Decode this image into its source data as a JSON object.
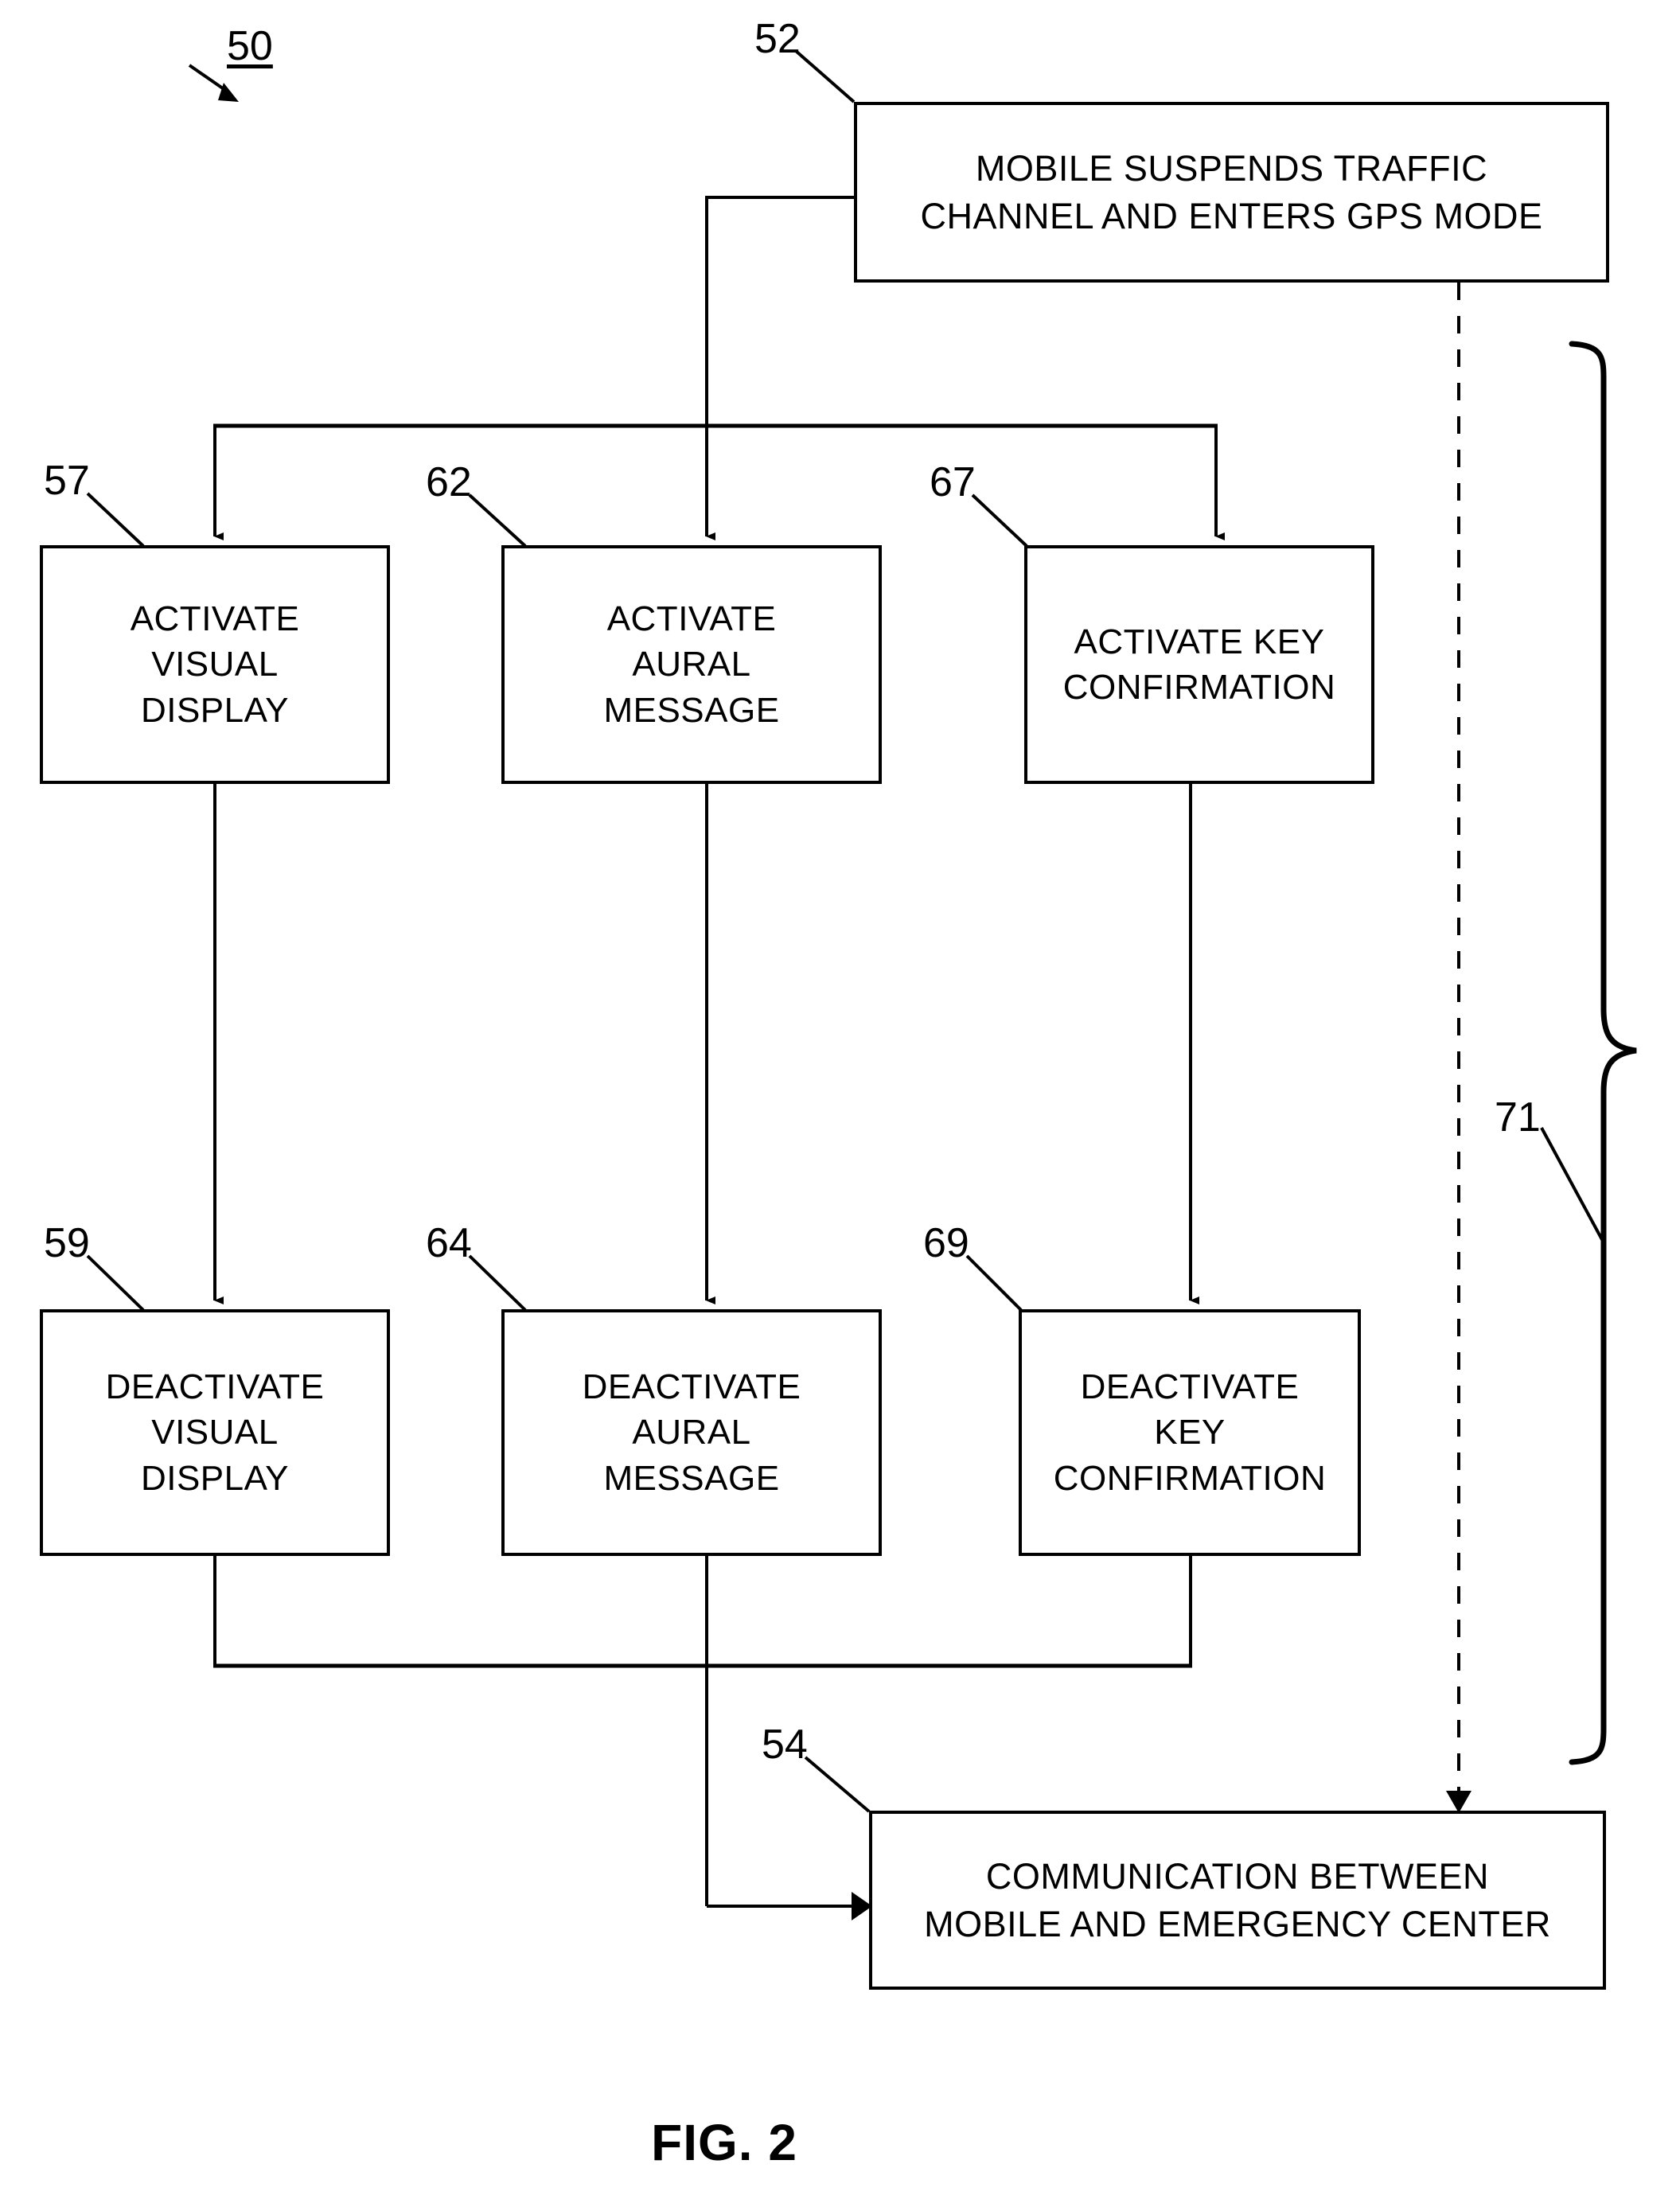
{
  "figure": {
    "caption": "FIG. 2",
    "diagram_ref": "50"
  },
  "nodes": [
    {
      "ref": "52",
      "name": "mobile-suspends-traffic",
      "text": "MOBILE SUSPENDS TRAFFIC\nCHANNEL AND ENTERS GPS MODE"
    },
    {
      "ref": "57",
      "name": "activate-visual-display",
      "text": "ACTIVATE\nVISUAL\nDISPLAY"
    },
    {
      "ref": "62",
      "name": "activate-aural-message",
      "text": "ACTIVATE\nAURAL\nMESSAGE"
    },
    {
      "ref": "67",
      "name": "activate-key-confirmation",
      "text": "ACTIVATE KEY\nCONFIRMATION"
    },
    {
      "ref": "59",
      "name": "deactivate-visual-display",
      "text": "DEACTIVATE\nVISUAL\nDISPLAY"
    },
    {
      "ref": "64",
      "name": "deactivate-aural-message",
      "text": "DEACTIVATE\nAURAL\nMESSAGE"
    },
    {
      "ref": "69",
      "name": "deactivate-key-confirmation",
      "text": "DEACTIVATE\nKEY\nCONFIRMATION"
    },
    {
      "ref": "54",
      "name": "communication-mobile-emergency-center",
      "text": "COMMUNICATION BETWEEN\nMOBILE AND EMERGENCY CENTER"
    }
  ],
  "brace": {
    "ref": "71",
    "name": "grouping-brace"
  },
  "colors": {
    "stroke": "#000000",
    "background": "#ffffff"
  }
}
